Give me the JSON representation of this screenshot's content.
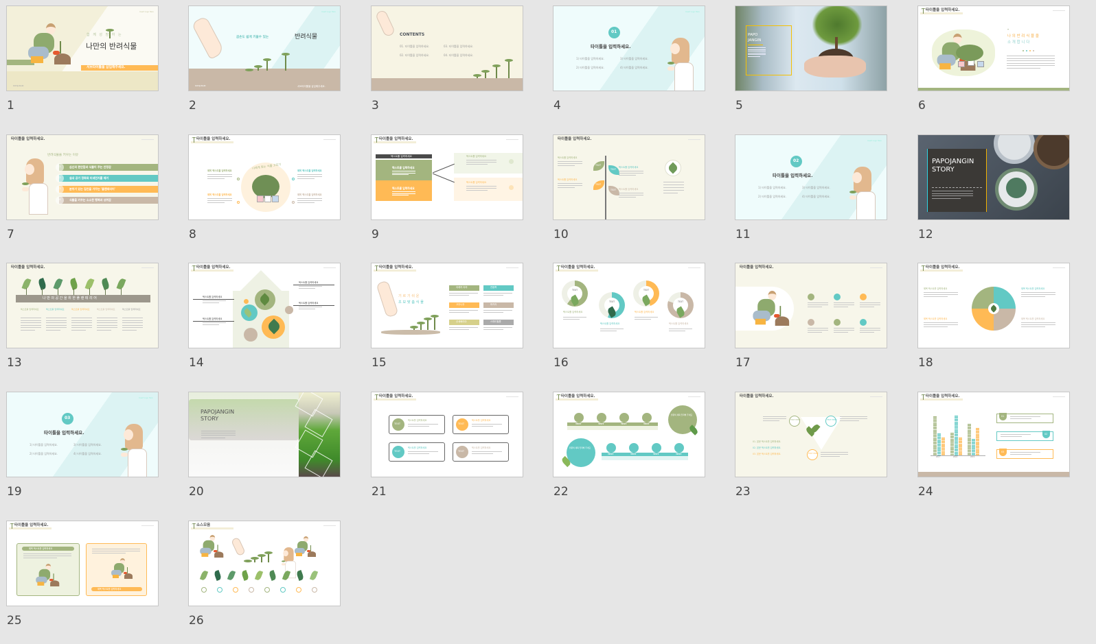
{
  "colors": {
    "green": "#a3b57f",
    "teal": "#62c9c4",
    "orange": "#ffba55",
    "beige": "#c9b8a7",
    "cream": "#f7f6ea",
    "dark": "#3b3936"
  },
  "slides": [
    {
      "num": "1",
      "sub": "함 께 성 장 하 는",
      "title": "나만의 반려식물",
      "banner": "서브타이틀을 삽입해주세요.",
      "logo": "Insert Logo Here",
      "brand": "PAPOJANGIN"
    },
    {
      "num": "2",
      "sub": "곰손도 쉽게 키울수 있는",
      "title": "반려식물",
      "banner": "서브타이틀을 삽입해주세요.",
      "logo": "Insert Logo Here",
      "brand": "PAPOJANGIN"
    },
    {
      "num": "3",
      "title": "CONTENTS",
      "items": [
        "01. 타이틀을 입력하세요.",
        "03. 타이틀을 입력하세요.",
        "02. 타이틀을 입력하세요.",
        "04. 타이틀을 입력하세요."
      ]
    },
    {
      "num": "4",
      "badge": "01",
      "title": "타이틀을 입력하세요.",
      "items": [
        "1) 타이틀을 입력하세요.",
        "3) 타이틀을 입력하세요.",
        "2) 타이틀을 입력하세요.",
        "4) 타이틀을 입력하세요."
      ],
      "logo": "Insert Logo Here"
    },
    {
      "num": "5",
      "title1": "PAPO",
      "title2": "JANGIN"
    },
    {
      "num": "6",
      "title": "타이틀을 입력하세요.",
      "heading1": "나 의  반 려 식 물 을",
      "heading2": "소  개  합  니  다"
    },
    {
      "num": "7",
      "title": "타이틀을 입력하세요.",
      "heading": "반려식물을 키우는 이유",
      "items": [
        {
          "n": "01",
          "t": "심신의 편안함과 식물이 주는 안정감"
        },
        {
          "n": "02",
          "t": "실내 공기 정화와 미세먼지를 제거"
        },
        {
          "n": "03",
          "t": "분위기 있는 집안을 가꾸는 '플랜테리어'"
        },
        {
          "n": "04",
          "t": "식물을 키우는 소소한 행복과 성취감"
        }
      ]
    },
    {
      "num": "8",
      "title": "타이틀을 입력하세요.",
      "arc": "나에게 맞는 식물 고르기",
      "labels": [
        "제목 텍스트를 입력하세요",
        "제목 텍스트를 입력하세요",
        "제목 텍스트를 입력하세요",
        "제목 텍스트를 입력하세요"
      ]
    },
    {
      "num": "9",
      "title": "타이틀을 입력하세요.",
      "quote": "텍스트를 입력하세요",
      "blocks": [
        "텍스트를 입력하세요",
        "텍스트를 입력하세요"
      ],
      "rows": [
        "텍스트를 입력하세요",
        "텍스트를 입력하세요"
      ]
    },
    {
      "num": "10",
      "title": "타이틀을 입력하세요.",
      "leaves": [
        "TEXT",
        "TEXT",
        "TEXT",
        "TEXT"
      ],
      "labels": [
        "텍스트를 입력하세요",
        "텍스트를 입력하세요",
        "텍스트를 입력하세요",
        "텍스트를 입력하세요"
      ]
    },
    {
      "num": "11",
      "badge": "02",
      "title": "타이틀을 입력하세요.",
      "items": [
        "1) 타이틀을 입력하세요.",
        "3) 타이틀을 입력하세요.",
        "2) 타이틀을 입력하세요.",
        "4) 타이틀을 입력하세요."
      ],
      "logo": "Insert Logo Here"
    },
    {
      "num": "12",
      "title1": "PAPOJANGIN",
      "title2": "STORY"
    },
    {
      "num": "13",
      "title": "타이틀을 입력하세요.",
      "banner": "나 만 의  공 간 을  위 한  플 랜 테 리 어",
      "cols": [
        "텍스트를 입력하세요",
        "텍스트를 입력하세요",
        "텍스트를 입력하세요",
        "텍스트를 입력하세요",
        "텍스트를 입력하세요"
      ]
    },
    {
      "num": "14",
      "title": "타이틀을 입력하세요.",
      "labels": [
        "텍스트를 입력하세요",
        "텍스트를 입력하세요",
        "텍스트를 입력하세요",
        "텍스트를 입력하세요"
      ]
    },
    {
      "num": "15",
      "title": "타이틀을 입력하세요.",
      "heading1": "기 르 기  쉬 운",
      "heading2": "초 보 맞 춤  식 물",
      "tags": [
        "아레카 야자",
        "관음죽",
        "고무나무",
        "파키라",
        "산세베리아",
        "스파티필름"
      ]
    },
    {
      "num": "16",
      "title": "타이틀을 입력하세요.",
      "donuts": [
        {
          "center": "TEXT",
          "label": "텍스트를 입력하세요",
          "fill": 0.6
        },
        {
          "center": "TEXT",
          "label": "텍스트를 입력하세요",
          "fill": 0.55
        },
        {
          "center": "TEXT",
          "label": "텍스트를 입력하세요",
          "fill": 0.45
        },
        {
          "center": "TEXT",
          "label": "텍스트를 입력하세요",
          "fill": 0.8
        }
      ]
    },
    {
      "num": "17",
      "title": "타이틀을 입력하세요."
    },
    {
      "num": "18",
      "title": "타이틀을 입력하세요.",
      "labels": [
        "제목 텍스트를 입력하세요",
        "제목 텍스트를 입력하세요",
        "제목 텍스트를 입력하세요",
        "제목 텍스트를 입력하세요"
      ]
    },
    {
      "num": "19",
      "badge": "03",
      "title": "타이틀을 입력하세요.",
      "items": [
        "1) 타이틀을 입력하세요.",
        "3) 타이틀을 입력하세요.",
        "2) 타이틀을 입력하세요.",
        "4) 타이틀을 입력하세요."
      ],
      "logo": "Insert Logo Here"
    },
    {
      "num": "20",
      "title1": "PAPOJANGIN",
      "title2": "STORY"
    },
    {
      "num": "21",
      "title": "타이틀을 입력하세요.",
      "cards": [
        {
          "icon": "TEXT",
          "label": "텍스트를 입력하세요"
        },
        {
          "icon": "TEXT",
          "label": "텍스트를 입력하세요"
        },
        {
          "icon": "TEXT",
          "label": "텍스트를 입력하세요"
        },
        {
          "icon": "TEXT",
          "label": "텍스트를 입력하세요"
        }
      ]
    },
    {
      "num": "22",
      "title": "타이틀을 입력하세요.",
      "top": [
        "TEXT",
        "TEXT",
        "TEXT",
        "TEXT"
      ],
      "bottom": [
        "TEXT",
        "TEXT",
        "TEXT",
        "TEXT"
      ],
      "circle1": "원문의 제목 입력해 주세요",
      "circle2": "원문의 제목 입력해 주세요"
    },
    {
      "num": "23",
      "title": "타이틀을 입력하세요.",
      "nodes": [
        "TEXT HERE",
        "TEXT HERE",
        "TEXT HERE"
      ],
      "list": [
        "01. 본문 텍스트를 입력하세요.",
        "02. 본문 텍스트를 입력하세요.",
        "03. 본문 텍스트를 입력하세요."
      ]
    },
    {
      "num": "24",
      "title": "타이틀을 입력하세요.",
      "cards": [
        "01",
        "02",
        "03"
      ],
      "chart": {
        "type": "bar",
        "categories": [
          "2017",
          "2018",
          "2019"
        ],
        "series": [
          {
            "name": "A",
            "values": [
              4.3,
              2.5,
              3.5
            ]
          },
          {
            "name": "B",
            "values": [
              2.4,
              4.4,
              1.8
            ]
          },
          {
            "name": "C",
            "values": [
              2,
              2,
              3
            ]
          }
        ],
        "ylim": [
          0,
          5
        ]
      }
    },
    {
      "num": "25",
      "title": "타이틀을 입력하세요.",
      "boxes": [
        "제목 텍스트를 입력하세요",
        "제목 텍스트를 입력하세요"
      ]
    },
    {
      "num": "26",
      "title": "소스모음"
    }
  ]
}
